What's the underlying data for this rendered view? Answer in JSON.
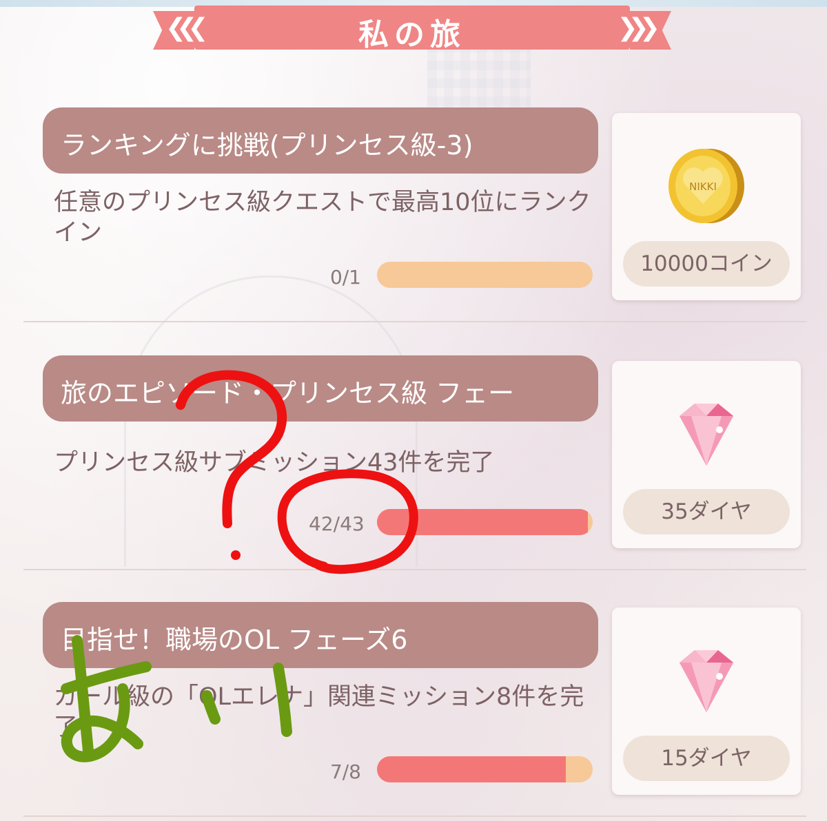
{
  "page": {
    "title": "私の旅"
  },
  "missions": [
    {
      "header": "ランキングに挑戦(プリンセス級-3)",
      "description": "任意のプリンセス級クエストで最高10位にランクイン",
      "progress_label": "0/1",
      "progress_fraction": 0.0,
      "reward_label": "10000コイン",
      "reward_icon": "coin-icon"
    },
    {
      "header": "旅のエピソード・プリンセス級 フェー",
      "description": "プリンセス級サブミッション43件を完了",
      "progress_label": "42/43",
      "progress_fraction": 0.977,
      "reward_label": "35ダイヤ",
      "reward_icon": "diamond-icon"
    },
    {
      "header": "目指せ！職場のOL フェーズ6",
      "description": "ガール級の「OLエレナ」関連ミッション8件を完了",
      "progress_label": "7/8",
      "progress_fraction": 0.875,
      "reward_label": "15ダイヤ",
      "reward_icon": "diamond-icon"
    }
  ],
  "coin_text": "NIKKI",
  "colors": {
    "ribbon": "#ef8585",
    "header": "#b98a86",
    "bar_track": "#f7c898",
    "bar_fill": "#f47777",
    "annotation_red": "#ee1111",
    "annotation_green": "#6a9a12"
  }
}
